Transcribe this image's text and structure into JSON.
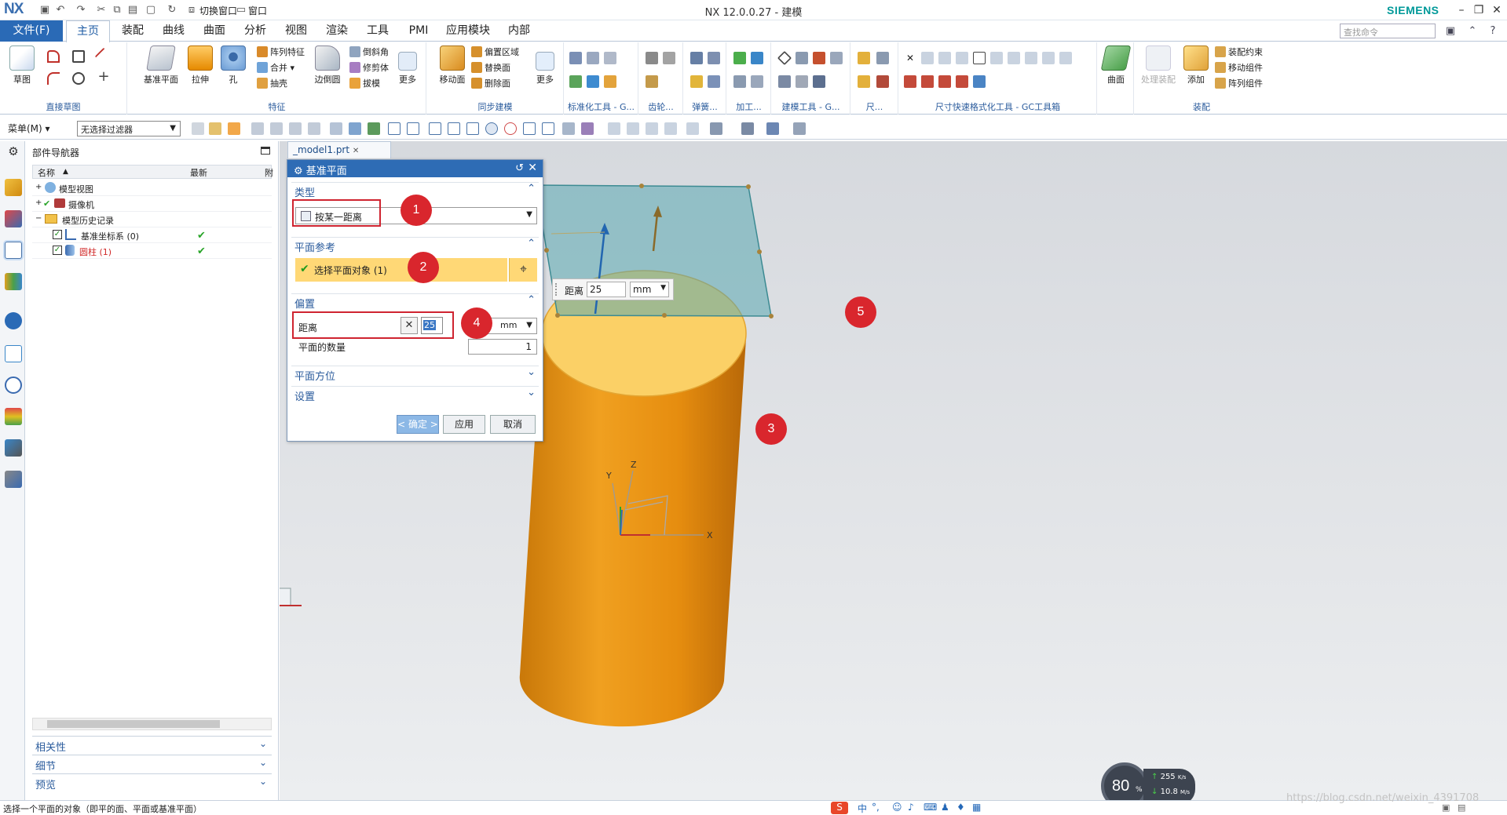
{
  "window": {
    "logo": "NX",
    "title": "NX 12.0.0.27 - 建模",
    "brand": "SIEMENS",
    "quick_switch_window": "切换窗口",
    "quick_window_menu": "窗口"
  },
  "tabs": [
    "文件(F)",
    "主页",
    "装配",
    "曲线",
    "曲面",
    "分析",
    "视图",
    "渲染",
    "工具",
    "PMI",
    "应用模块",
    "内部"
  ],
  "search_placeholder": "查找命令",
  "ribbon": {
    "direct_sketch": {
      "label": "直接草图",
      "sketch": "草图"
    },
    "feature": {
      "label": "特征",
      "datum_plane": "基准平面",
      "extrude": "拉伸",
      "hole": "孔",
      "pattern_feature": "阵列特征",
      "unite": "合并",
      "shell": "抽壳",
      "edge_blend": "边倒圆",
      "chamfer": "倒斜角",
      "trim_body": "修剪体",
      "draft": "拔模",
      "more": "更多"
    },
    "sync": {
      "label": "同步建模",
      "move_face": "移动面",
      "offset_region": "偏置区域",
      "replace_face": "替换面",
      "delete_face": "删除面",
      "more": "更多"
    },
    "gc_groups": [
      "标准化工具 - G...",
      "齿轮...",
      "弹簧...",
      "加工...",
      "建模工具 - G...",
      "尺...",
      "尺寸快速格式化工具 - GC工具箱"
    ],
    "surface": {
      "surface": "曲面"
    },
    "assembly": {
      "label": "装配",
      "process_assembly": "处理装配",
      "add": "添加",
      "assembly_constraint": "装配约束",
      "move_component": "移动组件",
      "pattern_component": "阵列组件"
    }
  },
  "toolbar": {
    "menu": "菜单(M)",
    "filter": "无选择过滤器"
  },
  "navigator": {
    "title": "部件导航器",
    "col_name": "名称",
    "col_latest": "最新",
    "col_extra": "附",
    "rows": [
      {
        "label": "模型视图",
        "latest": ""
      },
      {
        "label": "摄像机",
        "latest": ""
      },
      {
        "label": "模型历史记录",
        "latest": ""
      },
      {
        "label": "基准坐标系 (0)",
        "latest": "✔"
      },
      {
        "label": "圆柱 (1)",
        "latest": "✔"
      }
    ],
    "sections": [
      "相关性",
      "细节",
      "预览"
    ]
  },
  "document_tab": "_model1.prt",
  "dialog": {
    "title": "基准平面",
    "type_section": "类型",
    "type_value": "按某一距离",
    "plane_ref_section": "平面参考",
    "select_object": "选择平面对象 (1)",
    "offset_section": "偏置",
    "distance_label": "距离",
    "distance_value": "25",
    "unit": "mm",
    "num_planes_label": "平面的数量",
    "num_planes_value": "1",
    "plane_orientation_section": "平面方位",
    "settings_section": "设置",
    "ok": "< 确定 >",
    "apply": "应用",
    "cancel": "取消"
  },
  "osd": {
    "label": "距离",
    "value": "25",
    "unit": "mm"
  },
  "markers": [
    "1",
    "2",
    "3",
    "4",
    "5"
  ],
  "axes": {
    "x": "X",
    "y": "Y",
    "z": "Z"
  },
  "status": "选择一个平面的对象（即平的面、平面或基准平面）",
  "ime": [
    "中",
    "°,"
  ],
  "netmon": {
    "percent": "80",
    "unit": "%",
    "up": "255",
    "up_unit": "K/s",
    "down": "10.8",
    "down_unit": "M/s"
  },
  "watermark": "https://blog.csdn.net/weixin_4391708",
  "colors": {
    "accent": "#2a6ab6",
    "cylinder": "#e8940c",
    "cylinder_top": "#fbd066",
    "marker": "#d9262d",
    "plane": "#5aa8b0"
  }
}
